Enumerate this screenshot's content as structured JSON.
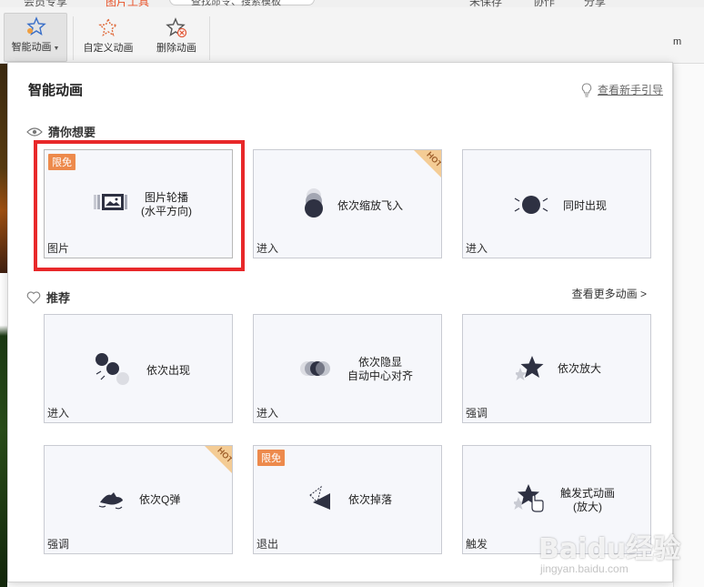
{
  "toolbar": {
    "tabs": [
      "会员专享",
      "图片工具",
      "查找命令、搜索模板",
      "未保存",
      "协作",
      "分享"
    ],
    "smart_animation": "智能动画",
    "custom_animation": "自定义动画",
    "delete_animation": "删除动画",
    "right_side_text": "m"
  },
  "panel": {
    "title": "智能动画",
    "guide_link": "查看新手引导",
    "section_guess": "猜你想要",
    "section_recommend": "推荐",
    "more_link": "查看更多动画 >"
  },
  "cards": [
    {
      "label": "图片轮播",
      "label2": "(水平方向)",
      "category": "图片",
      "badge": "限免",
      "hot": false
    },
    {
      "label": "依次缩放飞入",
      "label2": "",
      "category": "进入",
      "badge": "",
      "hot": true
    },
    {
      "label": "同时出现",
      "label2": "",
      "category": "进入",
      "badge": "",
      "hot": false
    },
    {
      "label": "依次出现",
      "label2": "",
      "category": "进入",
      "badge": "",
      "hot": false
    },
    {
      "label": "依次隐显",
      "label2": "自动中心对齐",
      "category": "进入",
      "badge": "",
      "hot": false
    },
    {
      "label": "依次放大",
      "label2": "",
      "category": "强调",
      "badge": "",
      "hot": false
    },
    {
      "label": "依次Q弹",
      "label2": "",
      "category": "强调",
      "badge": "",
      "hot": true
    },
    {
      "label": "依次掉落",
      "label2": "",
      "category": "退出",
      "badge": "限免",
      "hot": false
    },
    {
      "label": "触发式动画",
      "label2": "(放大)",
      "category": "触发",
      "badge": "",
      "hot": false
    }
  ],
  "hot_text": "HOT",
  "watermark": {
    "brand": "Baidu经验",
    "sub": "jingyan.baidu.com"
  },
  "colors": {
    "accent_orange": "#ed8a4c",
    "highlight_red": "#e8282a",
    "icon_dark": "#2e3142"
  }
}
